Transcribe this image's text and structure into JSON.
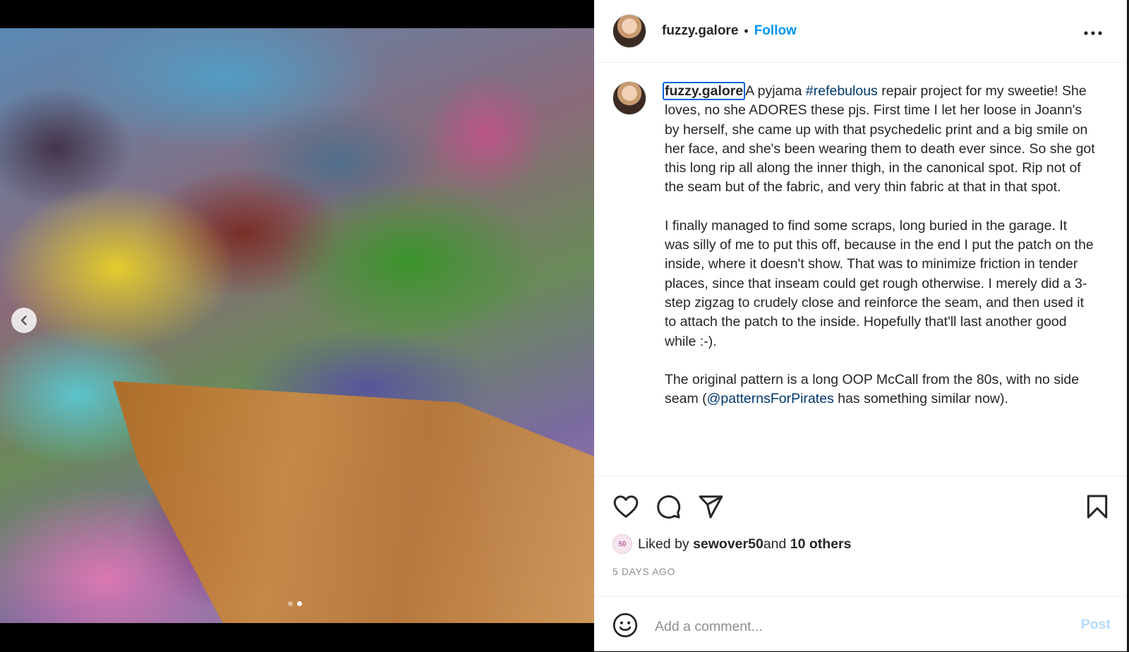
{
  "post": {
    "username": "fuzzy.galore",
    "separator": "•",
    "follow_label": "Follow",
    "more_label": "•••",
    "caption": {
      "username": "fuzzy.galore",
      "p1_before": "A pyjama ",
      "hashtag": "#refebulous",
      "p1_after": " repair project for my sweetie! She loves, no she ADORES these pjs. First time I let her loose in Joann's by herself, she came up with that psychedelic print and a big smile on her face, and she's been wearing them to death ever since. So she got this long rip all along the inner thigh, in the canonical spot. Rip not of the seam but of the fabric, and very thin fabric at that in that spot.",
      "p2": "I finally managed to find some scraps, long buried in the garage. It was silly of me to put this off, because in the end I put the patch on the inside, where it doesn't show. That was to minimize friction in tender places, since that inseam could get rough otherwise. I merely did a 3-step zigzag to crudely close and reinforce the seam, and then used it to attach the patch to the inside. Hopefully that'll last another good while :-).",
      "p3_before": "The original pattern is a long OOP McCall from the 80s, with no side seam (",
      "mention": "@patternsForPirates",
      "p3_after": " has something similar now)."
    },
    "likes": {
      "avatar_text": "50",
      "prefix": "Liked by ",
      "liker": "sewover50",
      "middle": " and ",
      "others": "10 others"
    },
    "date": "5 DAYS AGO",
    "comment": {
      "placeholder": "Add a comment...",
      "post_label": "Post"
    }
  },
  "media": {
    "carousel_total": 2,
    "carousel_active": 2
  },
  "colors": {
    "accent": "#0095f6",
    "tag": "#00376b",
    "post_disabled": "#b3dbff"
  },
  "icons": [
    "chevron-left-icon",
    "heart-icon",
    "comment-icon",
    "share-icon",
    "bookmark-icon",
    "smile-icon",
    "more-icon"
  ]
}
